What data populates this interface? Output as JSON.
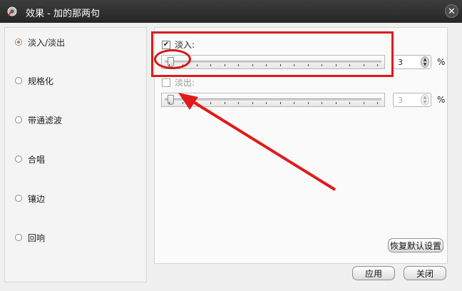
{
  "window": {
    "title": "效果 - 加的那两句",
    "close_glyph": "✕"
  },
  "sidebar": {
    "items": [
      {
        "label": "淡入/淡出",
        "selected": true
      },
      {
        "label": "规格化",
        "selected": false
      },
      {
        "label": "带通滤波",
        "selected": false
      },
      {
        "label": "合唱",
        "selected": false
      },
      {
        "label": "镶边",
        "selected": false
      },
      {
        "label": "回响",
        "selected": false
      }
    ]
  },
  "fade_in": {
    "label": "淡入:",
    "checked": true,
    "value": "3",
    "unit": "%"
  },
  "fade_out": {
    "label": "淡出:",
    "checked": false,
    "value": "3",
    "unit": "%"
  },
  "buttons": {
    "restore_defaults": "恢复默认设置",
    "apply": "应用",
    "close": "关闭"
  },
  "annotations": {
    "color": "#e01a1a"
  }
}
